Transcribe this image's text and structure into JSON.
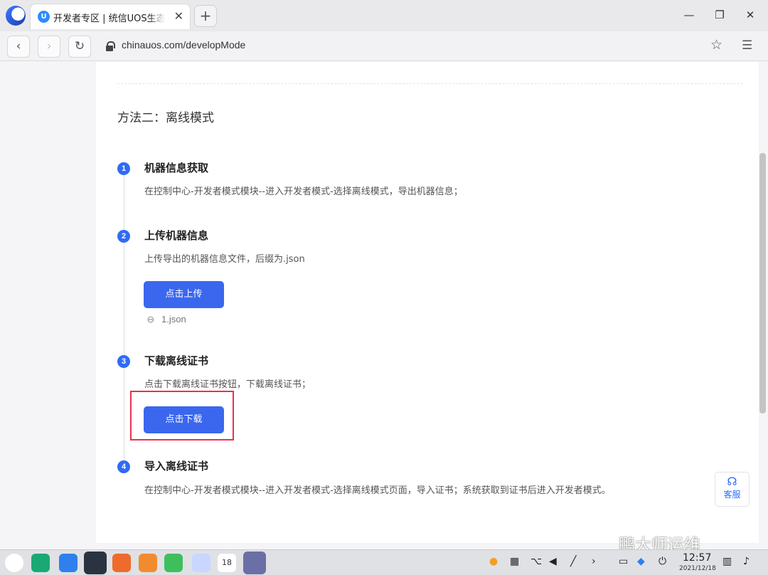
{
  "browser": {
    "tab_title": "开发者专区 | 统信UOS生态社区",
    "tab_favicon": "U",
    "close_glyph": "✕",
    "new_tab_glyph": "+",
    "url": "chinauos.com/developMode"
  },
  "page": {
    "section_title": "方法二：离线模式",
    "steps": [
      {
        "num": "1",
        "title": "机器信息获取",
        "desc": "在控制中心-开发者模式模块--进入开发者模式-选择离线模式，导出机器信息；"
      },
      {
        "num": "2",
        "title": "上传机器信息",
        "desc": "上传导出的机器信息文件，后缀为.json",
        "button": "点击上传",
        "file": "1.json"
      },
      {
        "num": "3",
        "title": "下载离线证书",
        "desc": "点击下载离线证书按钮，下载离线证书；",
        "button": "点击下载"
      },
      {
        "num": "4",
        "title": "导入离线证书",
        "desc": "在控制中心-开发者模式模块--进入开发者模式-选择离线模式页面，导入证书；系统获取到证书后进入开发者模式。"
      }
    ],
    "support_label": "客服"
  },
  "taskbar": {
    "time": "12:57",
    "date": "2021/12/18",
    "calendar_day": "18"
  },
  "watermark": "鹏大师运维",
  "icons": [
    "browser-logo-icon",
    "tab-favicon-icon",
    "close-icon",
    "plus-icon",
    "minimize-icon",
    "maximize-icon",
    "back-icon",
    "forward-icon",
    "reload-icon",
    "lock-icon",
    "star-icon",
    "menu-icon",
    "paperclip-icon",
    "headset-icon"
  ],
  "colors": {
    "primary": "#3a67ee",
    "step": "#2f6bf5",
    "highlight": "#e8304f"
  }
}
